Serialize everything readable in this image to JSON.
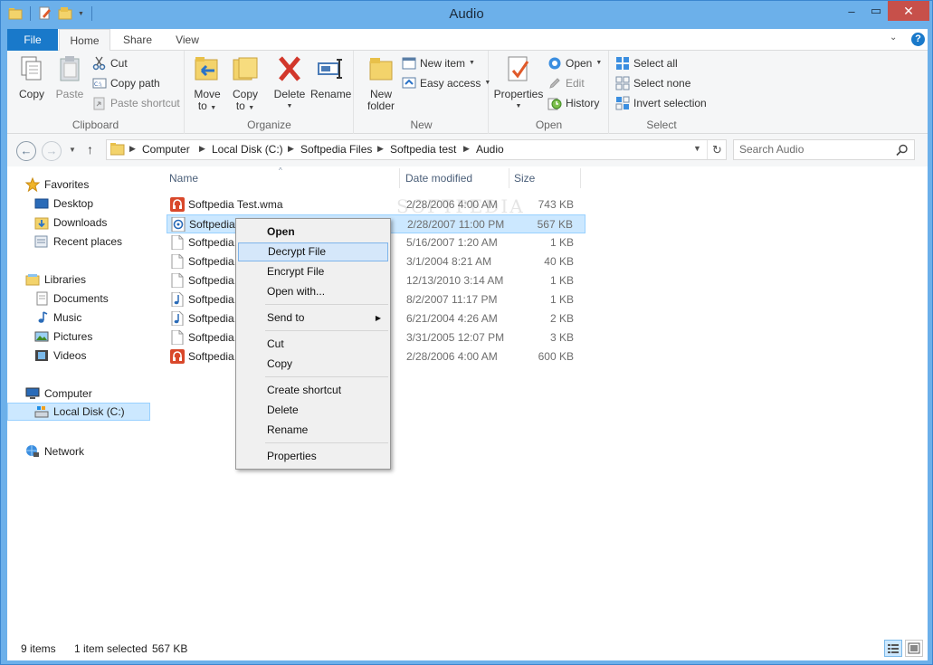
{
  "window": {
    "title": "Audio",
    "controls": {
      "minimize": "–",
      "maximize": "▭",
      "close": "✕"
    }
  },
  "ribbon_tabs": [
    "File",
    "Home",
    "Share",
    "View"
  ],
  "ribbon": {
    "clipboard": {
      "label": "Clipboard",
      "copy": "Copy",
      "paste": "Paste",
      "cut": "Cut",
      "copy_path": "Copy path",
      "paste_shortcut": "Paste shortcut"
    },
    "organize": {
      "label": "Organize",
      "move_to": [
        "Move",
        "to"
      ],
      "copy_to": [
        "Copy",
        "to"
      ],
      "delete": "Delete",
      "rename": "Rename"
    },
    "new": {
      "label": "New",
      "new_folder": [
        "New",
        "folder"
      ],
      "new_item": "New item",
      "easy_access": "Easy access"
    },
    "open": {
      "label": "Open",
      "properties": "Properties",
      "open": "Open",
      "edit": "Edit",
      "history": "History"
    },
    "select": {
      "label": "Select",
      "select_all": "Select all",
      "select_none": "Select none",
      "invert_selection": "Invert selection"
    }
  },
  "address": {
    "crumbs": [
      "Computer",
      "Local Disk (C:)",
      "Softpedia Files",
      "Softpedia test",
      "Audio"
    ],
    "search_placeholder": "Search Audio"
  },
  "nav_pane": {
    "favorites": "Favorites",
    "desktop": "Desktop",
    "downloads": "Downloads",
    "recent": "Recent places",
    "libraries": "Libraries",
    "documents": "Documents",
    "music": "Music",
    "pictures": "Pictures",
    "videos": "Videos",
    "computer": "Computer",
    "local_disk": "Local Disk (C:)",
    "network": "Network"
  },
  "columns": {
    "name": "Name",
    "date": "Date modified",
    "size": "Size"
  },
  "watermark": "SOFTPEDIA",
  "files": [
    {
      "name": "Softpedia Test.wma",
      "date": "2/28/2006 4:00 AM",
      "size": "743 KB",
      "icon": "wma-icon"
    },
    {
      "name": "Softpedia.",
      "date": "2/28/2007 11:00 PM",
      "size": "567 KB",
      "icon": "encrypted-audio-icon"
    },
    {
      "name": "Softpedia.",
      "date": "5/16/2007 1:20 AM",
      "size": "1 KB",
      "icon": "file-icon"
    },
    {
      "name": "Softpedia.",
      "date": "3/1/2004 8:21 AM",
      "size": "40 KB",
      "icon": "file-icon"
    },
    {
      "name": "Softpedia.",
      "date": "12/13/2010 3:14 AM",
      "size": "1 KB",
      "icon": "file-icon"
    },
    {
      "name": "Softpedia.",
      "date": "8/2/2007 11:17 PM",
      "size": "1 KB",
      "icon": "music-note-icon"
    },
    {
      "name": "Softpedia.",
      "date": "6/21/2004 4:26 AM",
      "size": "2 KB",
      "icon": "music-note-icon"
    },
    {
      "name": "Softpedia.",
      "date": "3/31/2005 12:07 PM",
      "size": "3 KB",
      "icon": "file-icon"
    },
    {
      "name": "Softpedia.",
      "date": "2/28/2006 4:00 AM",
      "size": "600 KB",
      "icon": "wma-icon"
    }
  ],
  "context_menu": {
    "open": "Open",
    "decrypt": "Decrypt File",
    "encrypt": "Encrypt File",
    "open_with": "Open with...",
    "send_to": "Send to",
    "cut": "Cut",
    "copy": "Copy",
    "create_shortcut": "Create shortcut",
    "delete": "Delete",
    "rename": "Rename",
    "properties": "Properties"
  },
  "status": {
    "items": "9 items",
    "selected": "1 item selected",
    "selected_size": "567 KB"
  },
  "colors": {
    "titlebar": "#6cb0ea",
    "file_tab": "#1979ca",
    "selection": "#cce8ff",
    "close_button": "#c7504a"
  }
}
